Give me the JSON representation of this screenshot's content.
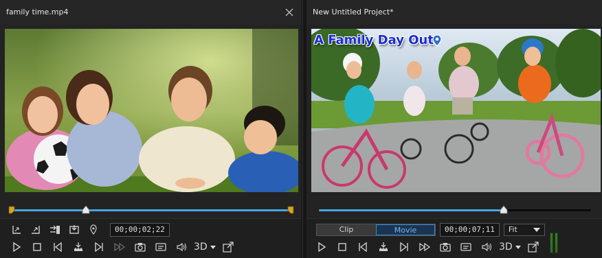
{
  "left": {
    "title": "family time.mp4",
    "timecode": "00;00;02;22",
    "scrub": {
      "progress": 0.27
    },
    "top_controls": [
      {
        "name": "mark-in-icon"
      },
      {
        "name": "mark-out-icon"
      },
      {
        "name": "insert-icon"
      },
      {
        "name": "overwrite-icon"
      },
      {
        "name": "location-icon"
      }
    ],
    "playback": {
      "three_d_label": "3D"
    }
  },
  "right": {
    "title": "New Untitled Project*",
    "overlay_title": "A Family Day Out",
    "scrub": {
      "progress": 0.68
    },
    "mode_toggle": {
      "clip": "Clip",
      "movie": "Movie",
      "active": "Movie"
    },
    "timecode": "00;00;07;11",
    "fit_select": "Fit",
    "playback": {
      "three_d_label": "3D"
    }
  },
  "colors": {
    "accent_blue": "#46a6e0",
    "mark_gold": "#d8a522",
    "overlay_title_blue": "#1a2bd6"
  }
}
